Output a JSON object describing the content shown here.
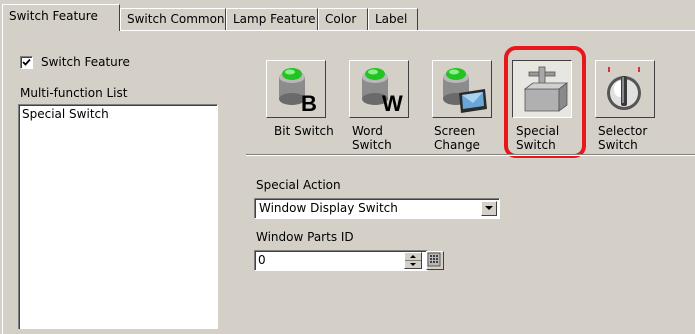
{
  "tabs": [
    {
      "label": "Switch Feature",
      "active": true
    },
    {
      "label": "Switch Common"
    },
    {
      "label": "Lamp Feature"
    },
    {
      "label": "Color"
    },
    {
      "label": "Label"
    }
  ],
  "switch_feature_checkbox": {
    "label": "Switch Feature",
    "checked": true
  },
  "multi_function_list": {
    "label": "Multi-function List",
    "items": [
      "Special Switch"
    ]
  },
  "switch_types": [
    {
      "line1": "Bit Switch",
      "line2": "",
      "icon": "bit-switch-icon"
    },
    {
      "line1": "Word",
      "line2": "Switch",
      "icon": "word-switch-icon"
    },
    {
      "line1": "Screen",
      "line2": "Change",
      "icon": "screen-change-icon"
    },
    {
      "line1": "Special",
      "line2": "Switch",
      "icon": "special-switch-icon",
      "selected": true
    },
    {
      "line1": "Selector",
      "line2": "Switch",
      "icon": "selector-switch-icon"
    }
  ],
  "special_action": {
    "label": "Special Action",
    "value": "Window Display Switch"
  },
  "window_parts_id": {
    "label": "Window Parts ID",
    "value": "0"
  },
  "colors": {
    "highlight": "#e8171c",
    "lamp_green": "#22c322"
  }
}
